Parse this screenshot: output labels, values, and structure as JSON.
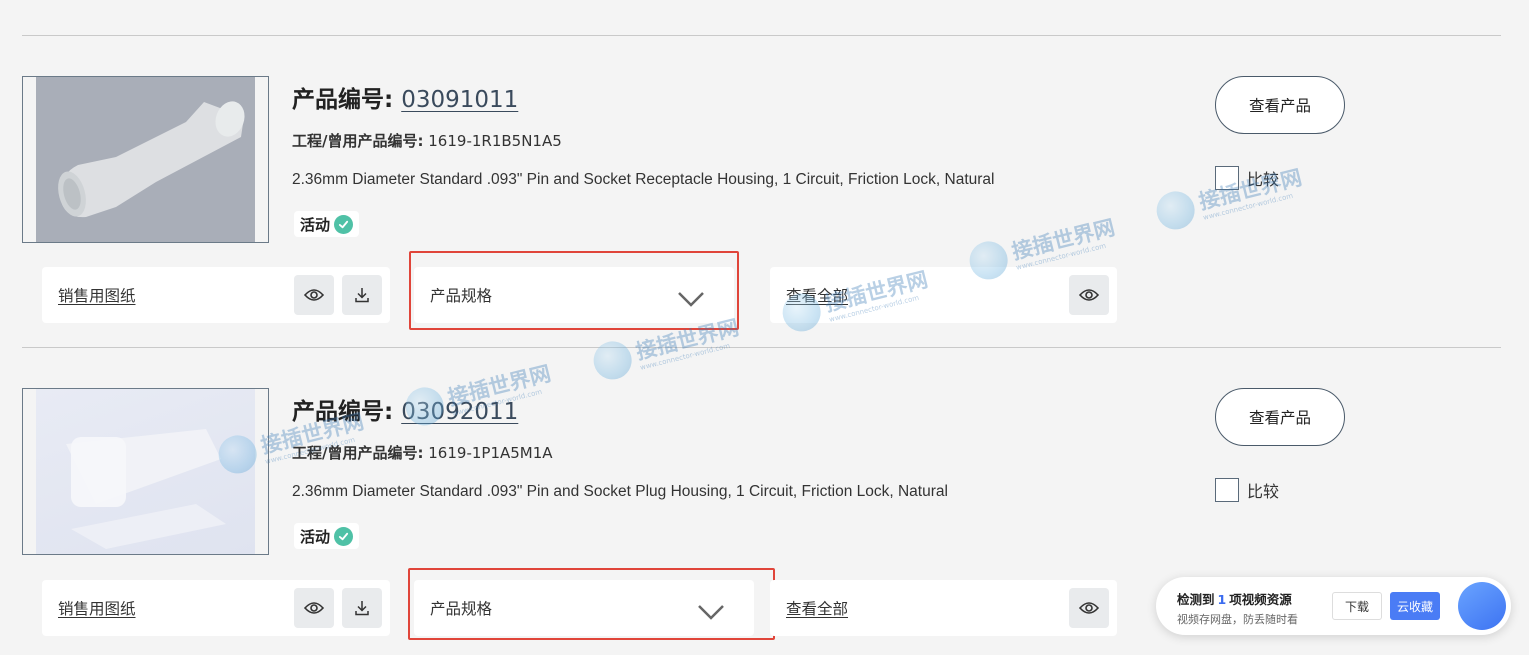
{
  "products": [
    {
      "title_label": "产品编号:",
      "part_number": "03091011",
      "eng_label": "工程/曾用产品编号:",
      "eng_number": "1619-1R1B5N1A5",
      "description": "2.36mm Diameter Standard .093\" Pin and Socket Receptacle Housing, 1 Circuit, Friction Lock, Natural",
      "status": "活动",
      "view_button": "查看产品",
      "compare_label": "比较",
      "drawing_label": "销售用图纸",
      "specs_label": "产品规格",
      "view_all_label": "查看全部"
    },
    {
      "title_label": "产品编号:",
      "part_number": "03092011",
      "eng_label": "工程/曾用产品编号:",
      "eng_number": "1619-1P1A5M1A",
      "description": "2.36mm Diameter Standard .093\" Pin and Socket Plug Housing, 1 Circuit, Friction Lock, Natural",
      "status": "活动",
      "view_button": "查看产品",
      "compare_label": "比较",
      "drawing_label": "销售用图纸",
      "specs_label": "产品规格",
      "view_all_label": "查看全部"
    }
  ],
  "watermark": {
    "text": "接插世界网",
    "sub": "www.connector-world.com"
  },
  "toast": {
    "prefix": "检测到",
    "count": "1",
    "suffix": "项视频资源",
    "sub": "视频存网盘，防丢随时看",
    "download": "下载",
    "cloud": "云收藏"
  },
  "colors": {
    "highlight_box": "#e0453a",
    "status_check": "#4fc1a6",
    "accent_blue": "#4a7cf5"
  }
}
